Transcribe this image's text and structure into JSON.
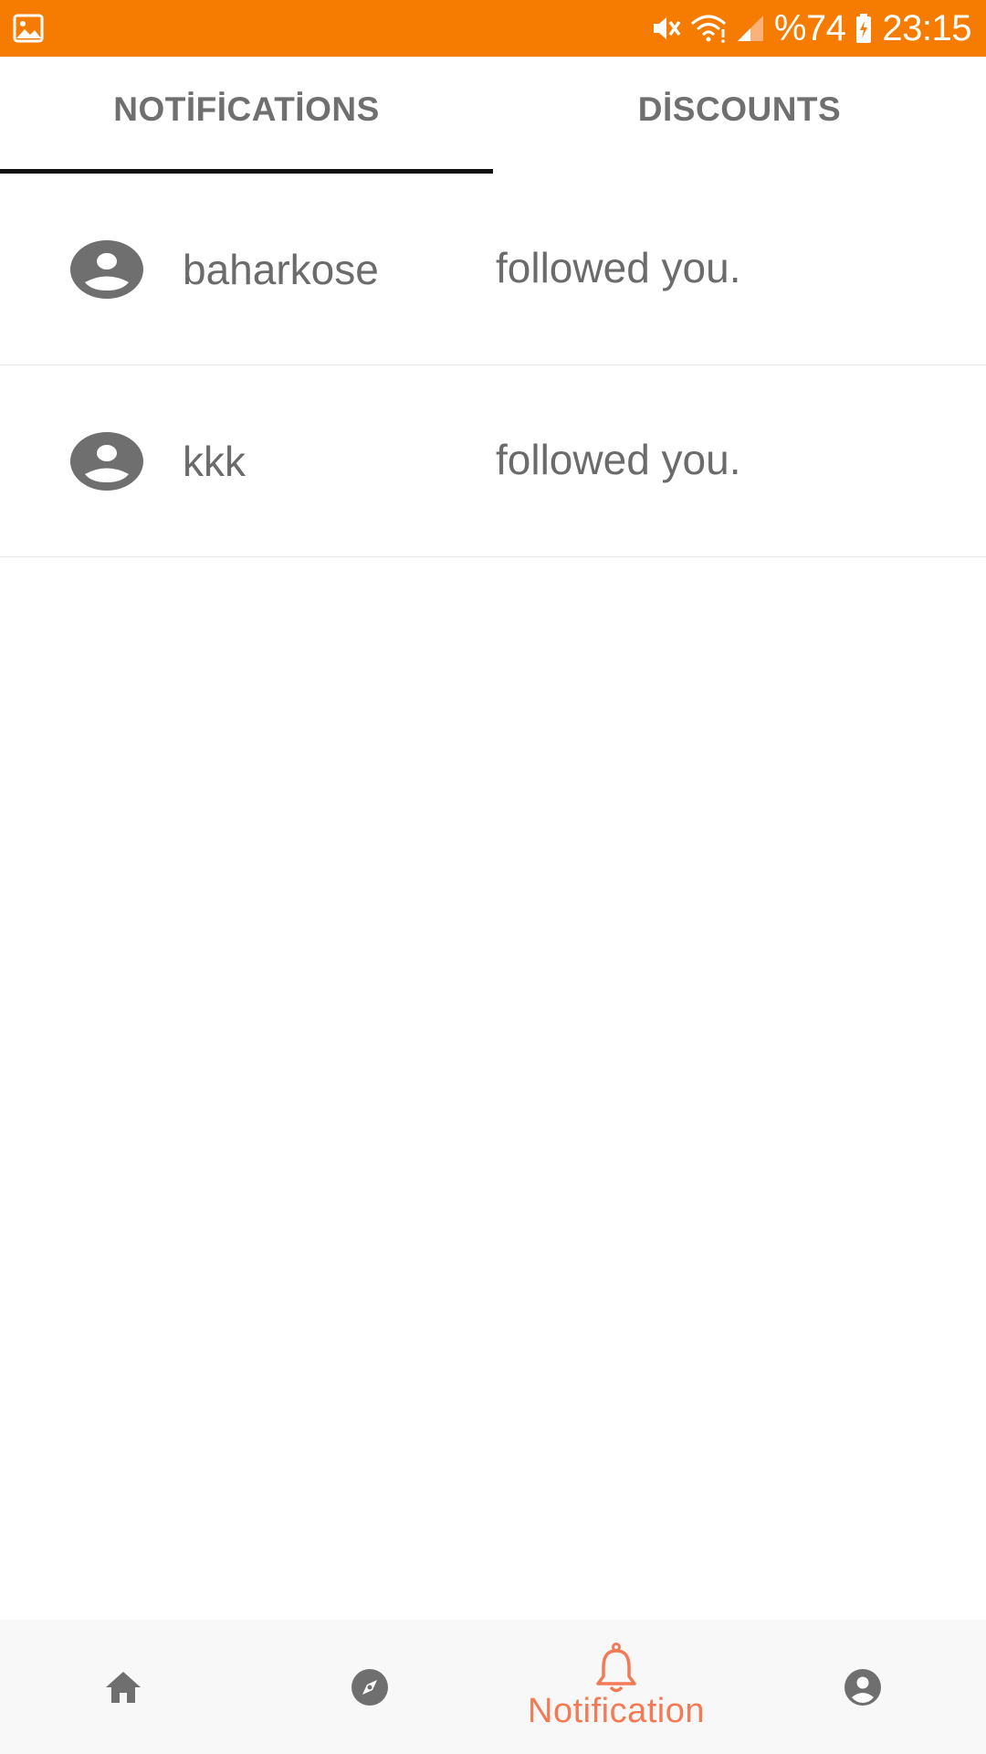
{
  "status_bar": {
    "battery_text": "%74",
    "time": "23:15",
    "icons": [
      "gallery-icon",
      "mute-icon",
      "wifi-icon",
      "signal-icon",
      "battery-charging-icon"
    ],
    "background_color": "#f57c00"
  },
  "tabs": [
    {
      "label": "NOTİFİCATİONS",
      "selected": true
    },
    {
      "label": "DİSCOUNTS",
      "selected": false
    }
  ],
  "notifications": [
    {
      "username": "baharkose",
      "message": "followed you.",
      "icon": "avatar-icon"
    },
    {
      "username": "kkk",
      "message": "followed you.",
      "icon": "avatar-icon"
    }
  ],
  "bottom_nav": {
    "items": [
      {
        "icon": "home-icon",
        "label": "",
        "active": false
      },
      {
        "icon": "compass-icon",
        "label": "",
        "active": false
      },
      {
        "icon": "bell-icon",
        "label": "Notification",
        "active": true
      },
      {
        "icon": "account-icon",
        "label": "",
        "active": false
      }
    ],
    "active_color": "#f37a55",
    "inactive_color": "#6f6f6f"
  }
}
